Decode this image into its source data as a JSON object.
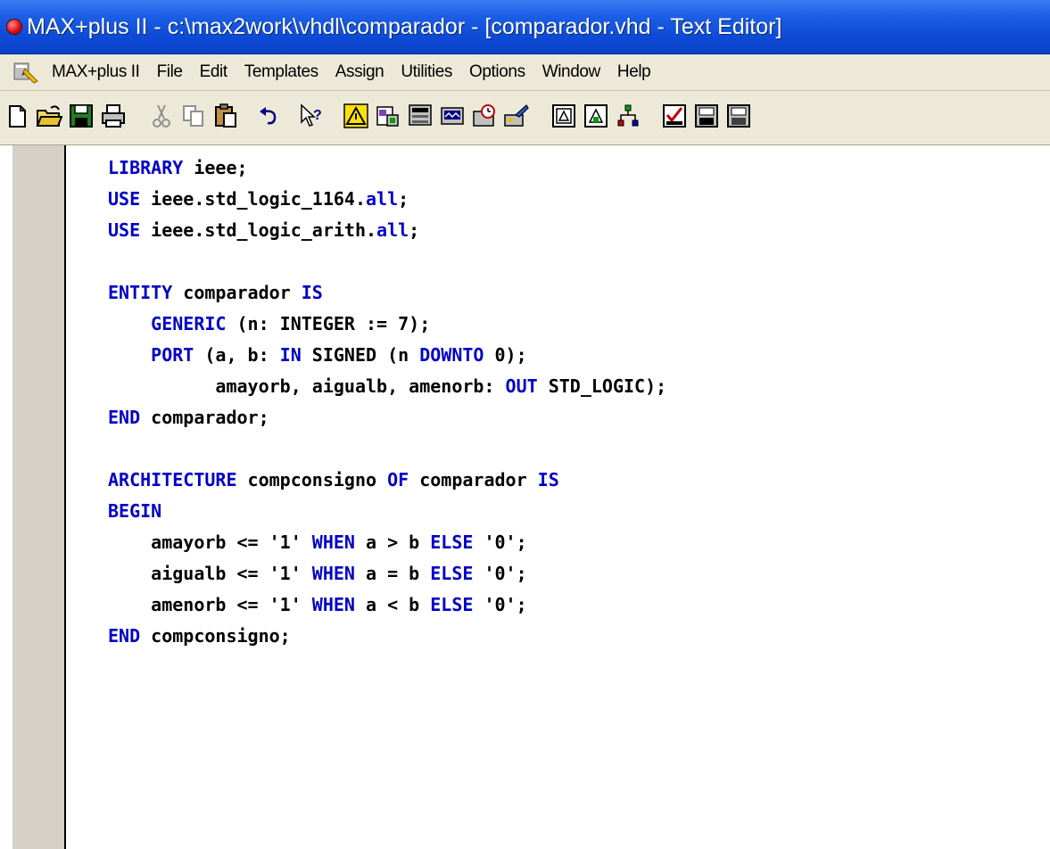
{
  "window": {
    "title": "MAX+plus II - c:\\max2work\\vhdl\\comparador - [comparador.vhd - Text Editor]"
  },
  "menubar": {
    "items": [
      "MAX+plus II",
      "File",
      "Edit",
      "Templates",
      "Assign",
      "Utilities",
      "Options",
      "Window",
      "Help"
    ]
  },
  "toolbar": {
    "buttons": [
      {
        "name": "new-file-icon"
      },
      {
        "name": "open-folder-icon"
      },
      {
        "name": "save-icon"
      },
      {
        "name": "print-icon"
      },
      {
        "name": "cut-icon"
      },
      {
        "name": "copy-icon"
      },
      {
        "name": "paste-icon"
      },
      {
        "name": "undo-icon"
      },
      {
        "name": "context-help-icon"
      },
      {
        "name": "hierarchy-display-icon"
      },
      {
        "name": "floorplan-editor-icon"
      },
      {
        "name": "compiler-icon"
      },
      {
        "name": "simulator-icon"
      },
      {
        "name": "timing-analyzer-icon"
      },
      {
        "name": "programmer-icon"
      },
      {
        "name": "open-editor-icon"
      },
      {
        "name": "graphic-editor-icon"
      },
      {
        "name": "waveform-editor-icon"
      },
      {
        "name": "save-check-icon"
      },
      {
        "name": "save-compile-icon"
      },
      {
        "name": "save-simulate-icon"
      }
    ]
  },
  "colors": {
    "keyword": "#0000c8",
    "text": "#000000",
    "title_bar": "#0d4ad6",
    "chrome": "#ece9d8"
  },
  "editor": {
    "lines": [
      [
        {
          "t": "LIBRARY",
          "k": true
        },
        {
          "t": " ieee;"
        }
      ],
      [
        {
          "t": "USE",
          "k": true
        },
        {
          "t": " ieee.std_logic_1164."
        },
        {
          "t": "all",
          "k": true
        },
        {
          "t": ";"
        }
      ],
      [
        {
          "t": "USE",
          "k": true
        },
        {
          "t": " ieee.std_logic_arith."
        },
        {
          "t": "all",
          "k": true
        },
        {
          "t": ";"
        }
      ],
      [],
      [
        {
          "t": "ENTITY",
          "k": true
        },
        {
          "t": " comparador "
        },
        {
          "t": "IS",
          "k": true
        }
      ],
      [
        {
          "t": "    "
        },
        {
          "t": "GENERIC",
          "k": true
        },
        {
          "t": " (n: INTEGER := 7);"
        }
      ],
      [
        {
          "t": "    "
        },
        {
          "t": "PORT",
          "k": true
        },
        {
          "t": " (a, b: "
        },
        {
          "t": "IN",
          "k": true
        },
        {
          "t": " SIGNED (n "
        },
        {
          "t": "DOWNTO",
          "k": true
        },
        {
          "t": " 0);"
        }
      ],
      [
        {
          "t": "          amayorb, aigualb, amenorb: "
        },
        {
          "t": "OUT",
          "k": true
        },
        {
          "t": " STD_LOGIC);"
        }
      ],
      [
        {
          "t": "END",
          "k": true
        },
        {
          "t": " comparador;"
        }
      ],
      [],
      [
        {
          "t": "ARCHITECTURE",
          "k": true
        },
        {
          "t": " compconsigno "
        },
        {
          "t": "OF",
          "k": true
        },
        {
          "t": " comparador "
        },
        {
          "t": "IS",
          "k": true
        }
      ],
      [
        {
          "t": "BEGIN",
          "k": true
        }
      ],
      [
        {
          "t": "    amayorb <= '1' "
        },
        {
          "t": "WHEN",
          "k": true
        },
        {
          "t": " a > b "
        },
        {
          "t": "ELSE",
          "k": true
        },
        {
          "t": " '0';"
        }
      ],
      [
        {
          "t": "    aigualb <= '1' "
        },
        {
          "t": "WHEN",
          "k": true
        },
        {
          "t": " a = b "
        },
        {
          "t": "ELSE",
          "k": true
        },
        {
          "t": " '0';"
        }
      ],
      [
        {
          "t": "    amenorb <= '1' "
        },
        {
          "t": "WHEN",
          "k": true
        },
        {
          "t": " a < b "
        },
        {
          "t": "ELSE",
          "k": true
        },
        {
          "t": " '0';"
        }
      ],
      [
        {
          "t": "END",
          "k": true
        },
        {
          "t": " compconsigno;"
        }
      ]
    ]
  }
}
